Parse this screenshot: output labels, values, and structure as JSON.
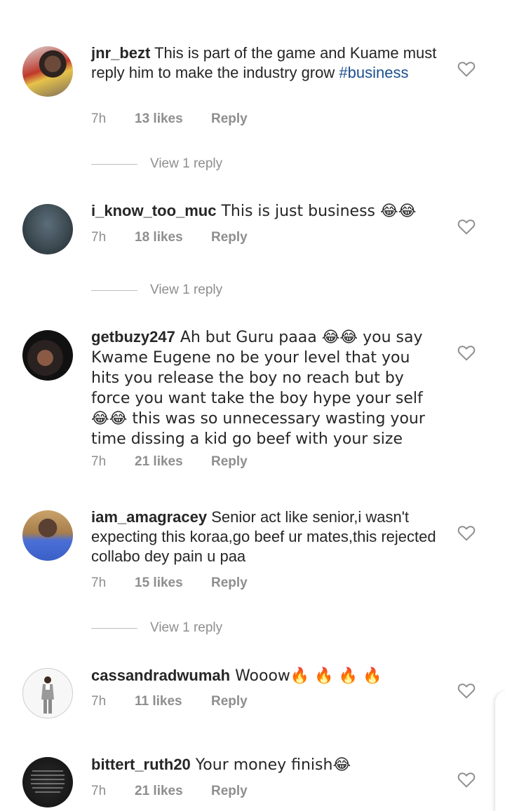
{
  "comments": [
    {
      "username": "jnr_bezt",
      "text": " This is part of the game and Kuame must reply him to make the industry grow ",
      "hashtag": "#business",
      "time": "7h",
      "likes": "13 likes",
      "reply_label": "Reply",
      "view_replies": "View 1 reply"
    },
    {
      "username": "i_know_too_muc",
      "text": " This is just business 😂😂",
      "time": "7h",
      "likes": "18 likes",
      "reply_label": "Reply",
      "view_replies": "View 1 reply"
    },
    {
      "username": "getbuzy247",
      "text": " Ah but Guru paaa 😂😂 you say Kwame Eugene no be your level that you hits you release the boy no reach but by force you want take the boy hype your self 😂😂 this was so unnecessary wasting your time dissing a kid go beef with your size",
      "time": "7h",
      "likes": "21 likes",
      "reply_label": "Reply"
    },
    {
      "username": "iam_amagracey",
      "text": " Senior act like senior,i wasn't expecting this koraa,go beef ur mates,this rejected collabo dey pain u paa",
      "time": "7h",
      "likes": "15 likes",
      "reply_label": "Reply",
      "view_replies": "View 1 reply"
    },
    {
      "username": "cassandradwumah",
      "text": " Wooow🔥 🔥 🔥 🔥",
      "time": "7h",
      "likes": "11 likes",
      "reply_label": "Reply"
    },
    {
      "username": "bittert_ruth20",
      "text": " Your money finish😂",
      "time": "7h",
      "likes": "21 likes",
      "reply_label": "Reply"
    }
  ],
  "icons": {
    "like": "heart-outline-icon"
  },
  "colors": {
    "text": "#262626",
    "meta": "#8e8e8e",
    "hashtag": "#1c4f8f"
  }
}
